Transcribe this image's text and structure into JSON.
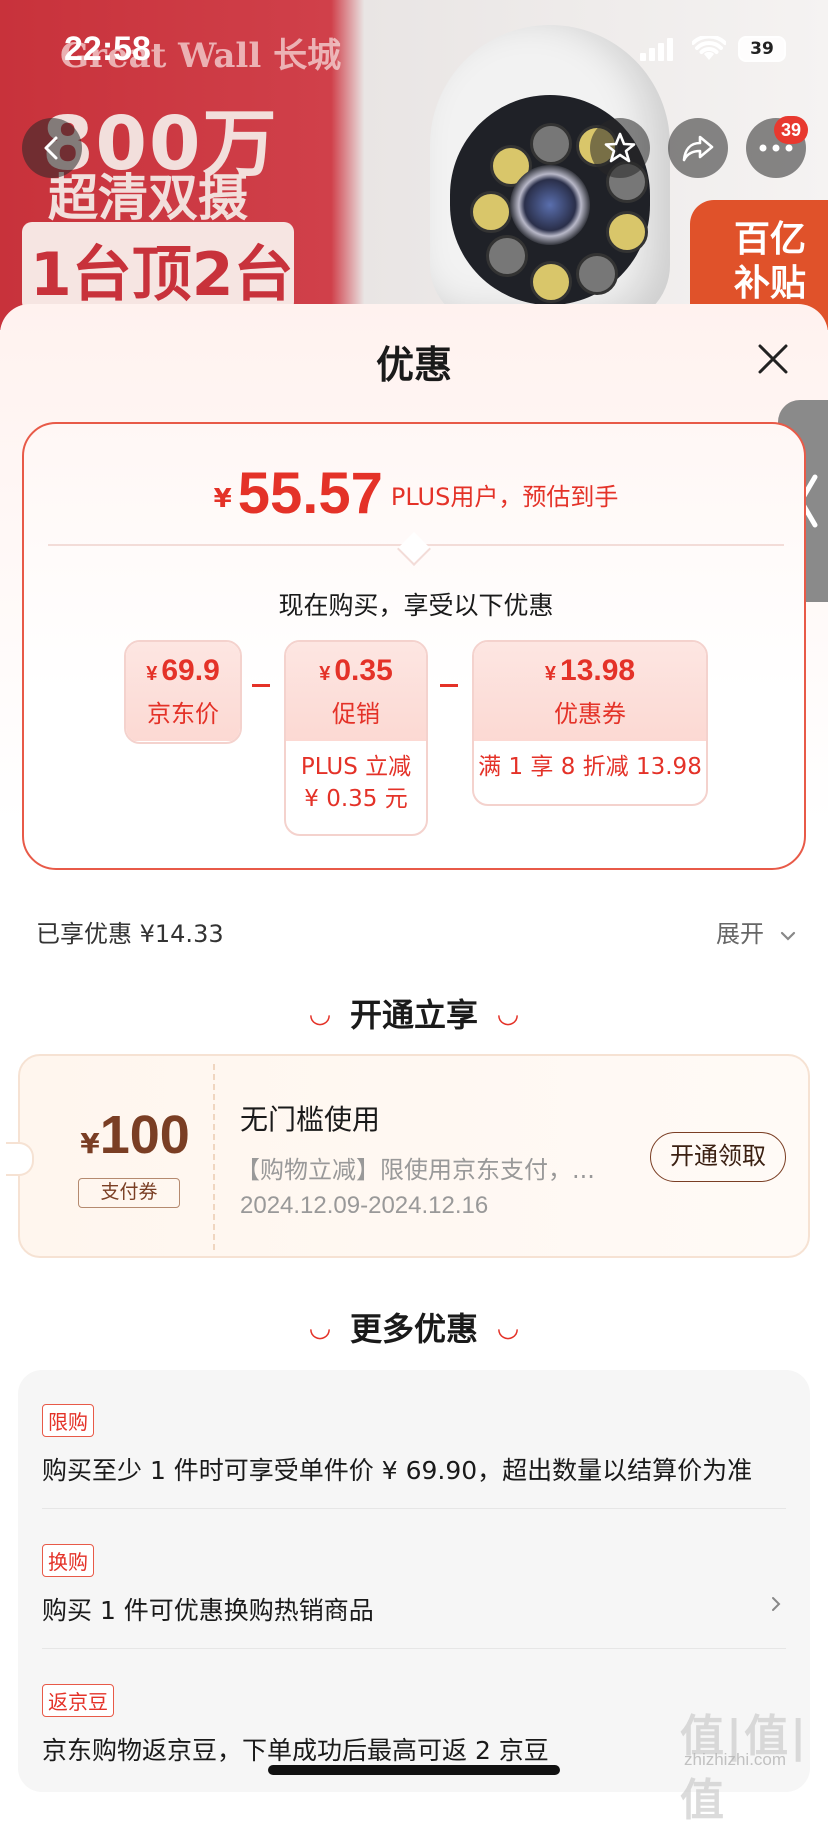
{
  "status": {
    "time": "22:58",
    "battery": "39"
  },
  "banner": {
    "brand": "Great Wall 长城",
    "headline": "800万",
    "subline": "超清双摄",
    "highlight": "1台顶2台",
    "subsidy": [
      "百亿",
      "补贴"
    ],
    "cart_badge": "39"
  },
  "sheet": {
    "title": "优惠",
    "price_card": {
      "currency": "¥",
      "final_price": "55.57",
      "note": "PLUS用户，预估到手",
      "subtitle": "现在购买，享受以下优惠",
      "items": [
        {
          "currency": "¥",
          "value": "69.9",
          "label": "京东价"
        },
        {
          "currency": "¥",
          "value": "0.35",
          "label": "促销",
          "detail": [
            "PLUS 立减",
            "¥ 0.35 元"
          ]
        },
        {
          "currency": "¥",
          "value": "13.98",
          "label": "优惠券",
          "detail": [
            "满 1 享 8 折减 13.98"
          ]
        }
      ],
      "operator": "−"
    },
    "enjoyed": "已享优惠 ¥14.33",
    "expand": "展开",
    "section1_title": "开通立享",
    "coupon": {
      "currency": "¥",
      "amount": "100",
      "tag": "支付券",
      "title": "无门槛使用",
      "desc": "【购物立减】限使用京东支付，...",
      "validity": "2024.12.09-2024.12.16",
      "button": "开通领取"
    },
    "section2_title": "更多优惠",
    "offers": [
      {
        "tag": "限购",
        "text": "购买至少 1 件时可享受单件价 ¥ 69.90，超出数量以结算价为准"
      },
      {
        "tag": "换购",
        "text": "购买 1 件可优惠换购热销商品"
      },
      {
        "tag": "返京豆",
        "text": "京东购物返京豆，下单成功后最高可返 2 京豆"
      }
    ]
  },
  "watermark": {
    "logo": "值|值|值",
    "site": "zhizhizhi.com"
  },
  "colors": {
    "accent": "#e43228",
    "coupon_brown": "#7a3e24",
    "border": "#e85a48"
  }
}
